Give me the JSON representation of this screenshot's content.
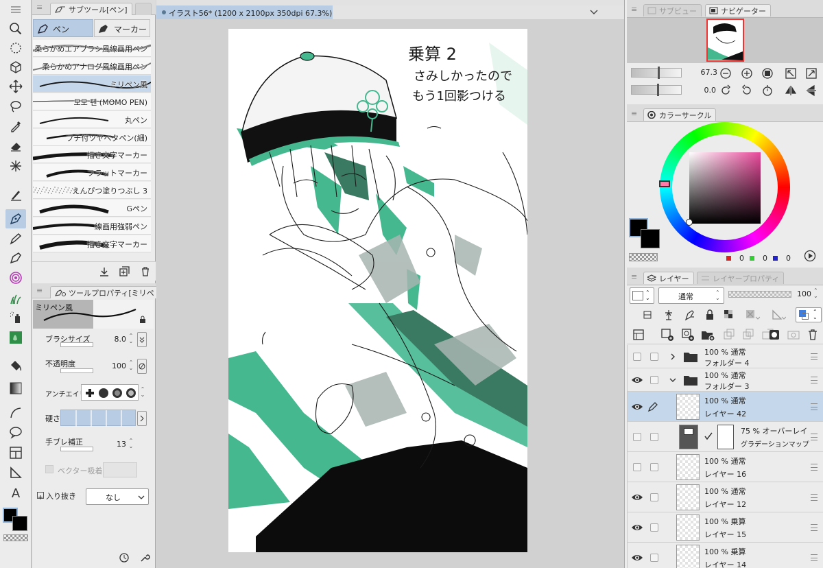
{
  "document": {
    "tab_title": "イラスト56* (1200 x 2100px 350dpi 67.3%)"
  },
  "subtool_panel": {
    "title": "サブツール[ペン]",
    "tabs": [
      {
        "label": "ペン",
        "icon": "pen-nib-icon",
        "active": true
      },
      {
        "label": "マーカー",
        "icon": "marker-icon",
        "active": false
      }
    ],
    "brushes": [
      {
        "name": "柔らかめエアブラシ風線画用ペン",
        "selected": false
      },
      {
        "name": "柔らかめアナログ風線画用ペン",
        "selected": false
      },
      {
        "name": "ミリペン風",
        "selected": true
      },
      {
        "name": "모모 펜 (MOMO PEN)",
        "selected": false
      },
      {
        "name": "丸ペン",
        "selected": false
      },
      {
        "name": "フチ付ツヤベタペン(細)",
        "selected": false
      },
      {
        "name": "描き文字マーカー",
        "selected": false
      },
      {
        "name": "フラットマーカー",
        "selected": false
      },
      {
        "name": "えんぴつ塗りつぶし 3",
        "selected": false
      },
      {
        "name": "Gペン",
        "selected": false
      },
      {
        "name": "線画用強弱ペン",
        "selected": false
      },
      {
        "name": "描き文字マーカー",
        "selected": false
      }
    ]
  },
  "tool_property": {
    "title": "ツールプロパティ[ミリペ",
    "preview_label": "ミリペン風",
    "brush_size_label": "ブラシサイズ",
    "brush_size_value": "8.0",
    "opacity_label": "不透明度",
    "opacity_value": "100",
    "antialias_label": "アンチエイリ",
    "hardness_label": "硬さ",
    "stabilization_label": "手ブレ補正",
    "stabilization_value": "13",
    "vector_snap_label": "ベクター吸着",
    "taper_label": "入り抜き",
    "taper_value": "なし"
  },
  "navigator": {
    "tabs": [
      {
        "label": "サブビュー",
        "active": false
      },
      {
        "label": "ナビゲーター",
        "active": true
      }
    ],
    "zoom_value": "67.3",
    "rotation_value": "0.0"
  },
  "color_circle": {
    "title": "カラーサークル",
    "r": "0",
    "g": "0",
    "b": "0",
    "main_color": "#000000",
    "sub_color": "#000000"
  },
  "layer_panel": {
    "tabs": [
      {
        "label": "レイヤー",
        "active": true
      },
      {
        "label": "レイヤープロパティ",
        "active": false
      }
    ],
    "blend_mode": "通常",
    "opacity_value": "100",
    "layers": [
      {
        "line1": "100 % 通常",
        "line2": "フォルダー 4",
        "type": "folder",
        "visible": false,
        "expanded": false,
        "selected": false
      },
      {
        "line1": "100 % 通常",
        "line2": "フォルダー 3",
        "type": "folder",
        "visible": true,
        "expanded": true,
        "selected": false
      },
      {
        "line1": "100 % 通常",
        "line2": "レイヤー 42",
        "type": "raster",
        "visible": true,
        "selected": true
      },
      {
        "line1": "75 % オーバーレイ",
        "line2": "グラデーションマップ",
        "type": "gradient-map",
        "visible": false,
        "selected": false
      },
      {
        "line1": "100 % 通常",
        "line2": "レイヤー 16",
        "type": "raster",
        "visible": false,
        "selected": false
      },
      {
        "line1": "100 % 通常",
        "line2": "レイヤー 12",
        "type": "raster",
        "visible": true,
        "selected": false
      },
      {
        "line1": "100 % 乗算",
        "line2": "レイヤー 15",
        "type": "raster",
        "visible": true,
        "selected": false
      },
      {
        "line1": "100 % 乗算",
        "line2": "レイヤー 14",
        "type": "raster",
        "visible": true,
        "selected": false
      }
    ]
  },
  "canvas_note": {
    "line1": "乗算 2",
    "line2": "さみしかったので",
    "line3": "もう1回影つける"
  },
  "accent_color": "#3dbb8e"
}
